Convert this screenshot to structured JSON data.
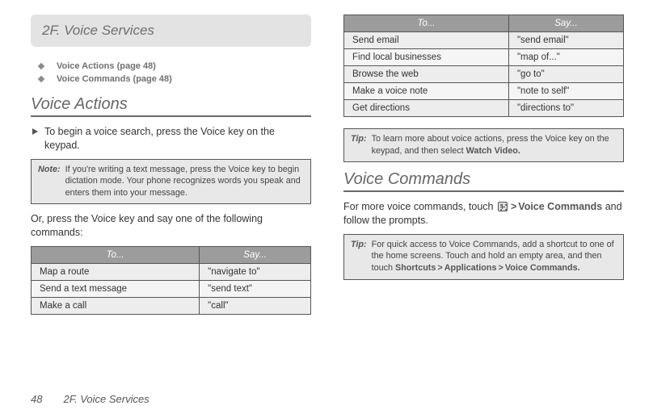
{
  "section_header": "2F.   Voice Services",
  "toc": [
    {
      "label": "Voice Actions (page 48)"
    },
    {
      "label": "Voice Commands (page 48)"
    }
  ],
  "h_voice_actions": "Voice Actions",
  "va_intro": "To begin a voice search, press the Voice key on the keypad.",
  "note_label": "Note:",
  "va_note": "If you're writing a text message, press the Voice key to begin dictation mode. Your phone recognizes words you speak and enters them into your message.",
  "va_or": "Or, press the Voice key and say one of the following commands:",
  "table_headers": {
    "to": "To...",
    "say": "Say..."
  },
  "table_left": [
    {
      "to": "Map a route",
      "say": "\"navigate to\""
    },
    {
      "to": "Send a text message",
      "say": "\"send text\""
    },
    {
      "to": "Make a call",
      "say": "\"call\""
    }
  ],
  "table_right": [
    {
      "to": "Send email",
      "say": "\"send email\""
    },
    {
      "to": "Find local businesses",
      "say": "\"map of...\""
    },
    {
      "to": "Browse the web",
      "say": "\"go to\""
    },
    {
      "to": "Make a voice note",
      "say": "\"note to self\""
    },
    {
      "to": "Get directions",
      "say": "\"directions to\""
    }
  ],
  "tip_label": "Tip:",
  "tip1_a": "To learn more about voice actions, press the Voice key on the keypad, and then select ",
  "tip1_b": "Watch Video.",
  "h_voice_commands": "Voice Commands",
  "vc_para_a": "For more voice commands, touch ",
  "vc_para_b": "Voice Commands",
  "vc_para_c": " and follow the prompts.",
  "tip2_a": "For quick access to Voice Commands, add a shortcut to one of the home screens. Touch and hold an empty area, and then touch ",
  "tip2_b": "Shortcuts",
  "tip2_c": "Applications",
  "tip2_d": "Voice Commands.",
  "footer_page": "48",
  "footer_section": "2F. Voice Services"
}
